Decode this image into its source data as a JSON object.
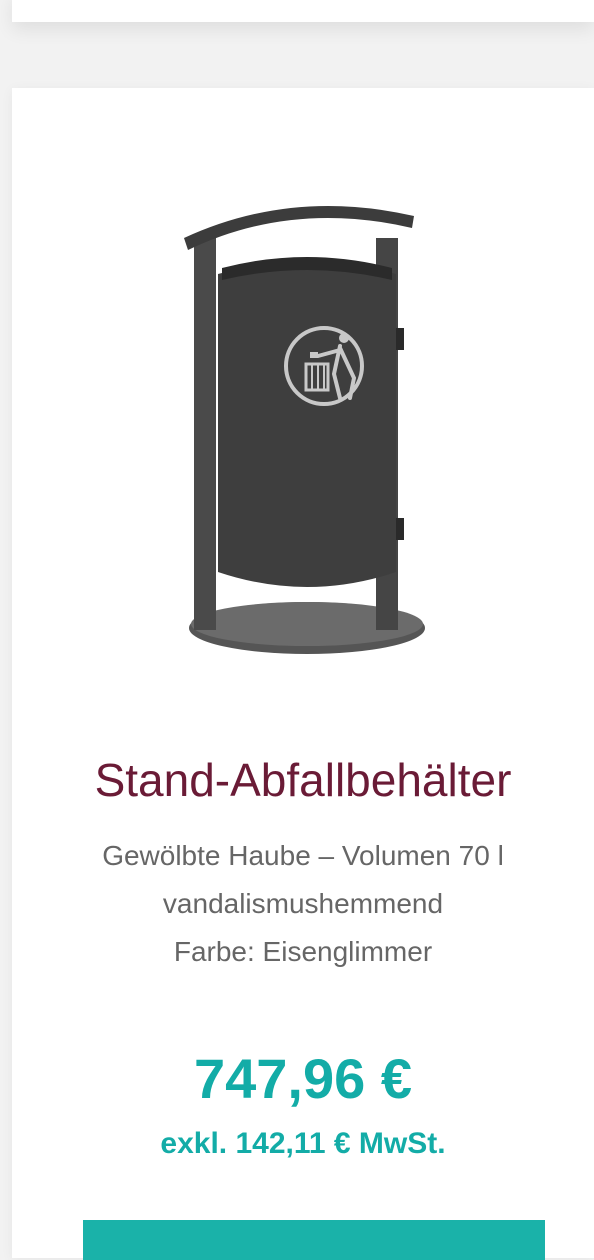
{
  "product": {
    "image_icon": "trash-bin-product-image",
    "title": "Stand-Abfallbehälter",
    "description_lines": [
      "Gewölbte Haube – Volumen 70 l",
      "vandalismushemmend",
      "Farbe: Eisenglimmer"
    ],
    "price": "747,96 €",
    "tax_note": "exkl. 142,11 € MwSt."
  },
  "colors": {
    "title": "#6a1b36",
    "accent": "#13aca7",
    "text": "#666666"
  }
}
